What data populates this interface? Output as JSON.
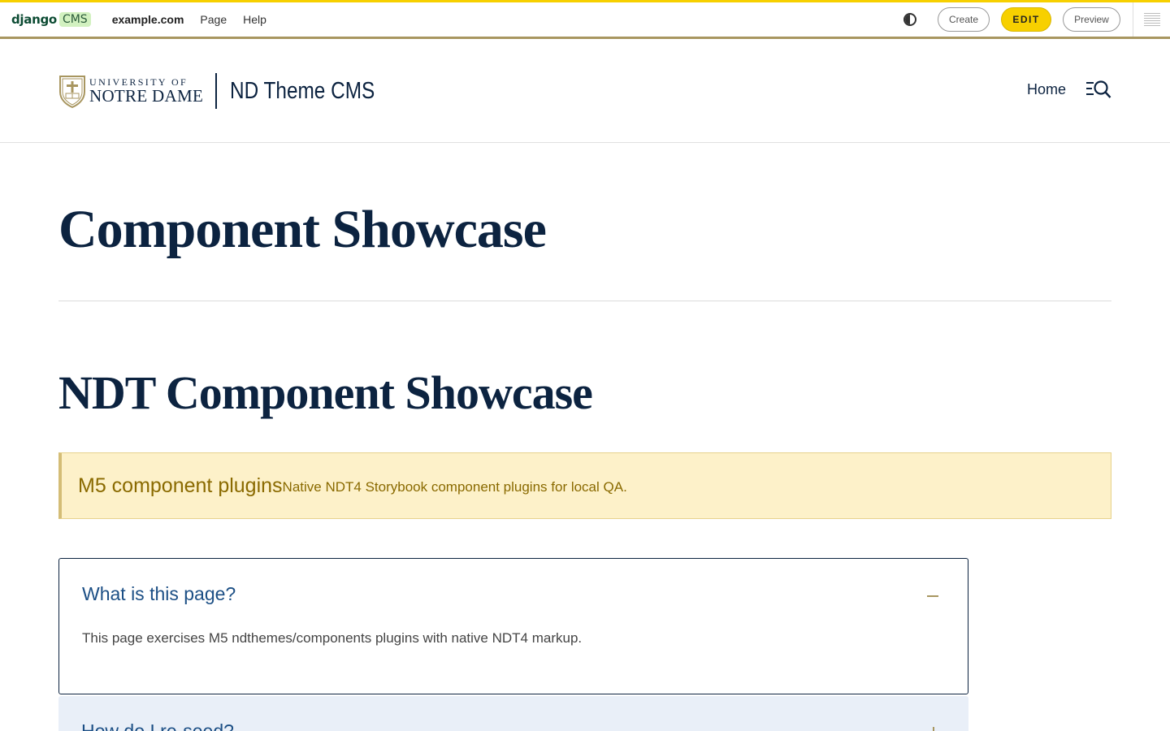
{
  "toolbar": {
    "logo_django": "django",
    "logo_cms": "CMS",
    "menu": [
      "example.com",
      "Page",
      "Help"
    ],
    "create_label": "Create",
    "edit_label": "EDIT",
    "preview_label": "Preview",
    "contrast_icon": "contrast-icon",
    "sidebar_icon": "structure-icon"
  },
  "header": {
    "university_line1": "UNIVERSITY OF",
    "university_line2": "NOTRE DAME",
    "site_name": "ND Theme CMS",
    "nav_home": "Home",
    "menu_search_icon": "menu-search-icon"
  },
  "page": {
    "title": "Component Showcase",
    "section_title": "NDT Component Showcase"
  },
  "alert": {
    "heading": "M5 component plugins",
    "text": "Native NDT4 Storybook component plugins for local QA."
  },
  "accordion": [
    {
      "question": "What is this page?",
      "answer": "This page exercises M5 ndthemes/components plugins with native NDT4 markup.",
      "expanded": true
    },
    {
      "question": "How do I re-seed?",
      "expanded": false
    }
  ],
  "colors": {
    "navy": "#0c2340",
    "gold": "#a89660",
    "toolbar_yellow": "#f7d000",
    "alert_bg": "#fdf1c9",
    "accordion_blue": "#1c4f85"
  }
}
